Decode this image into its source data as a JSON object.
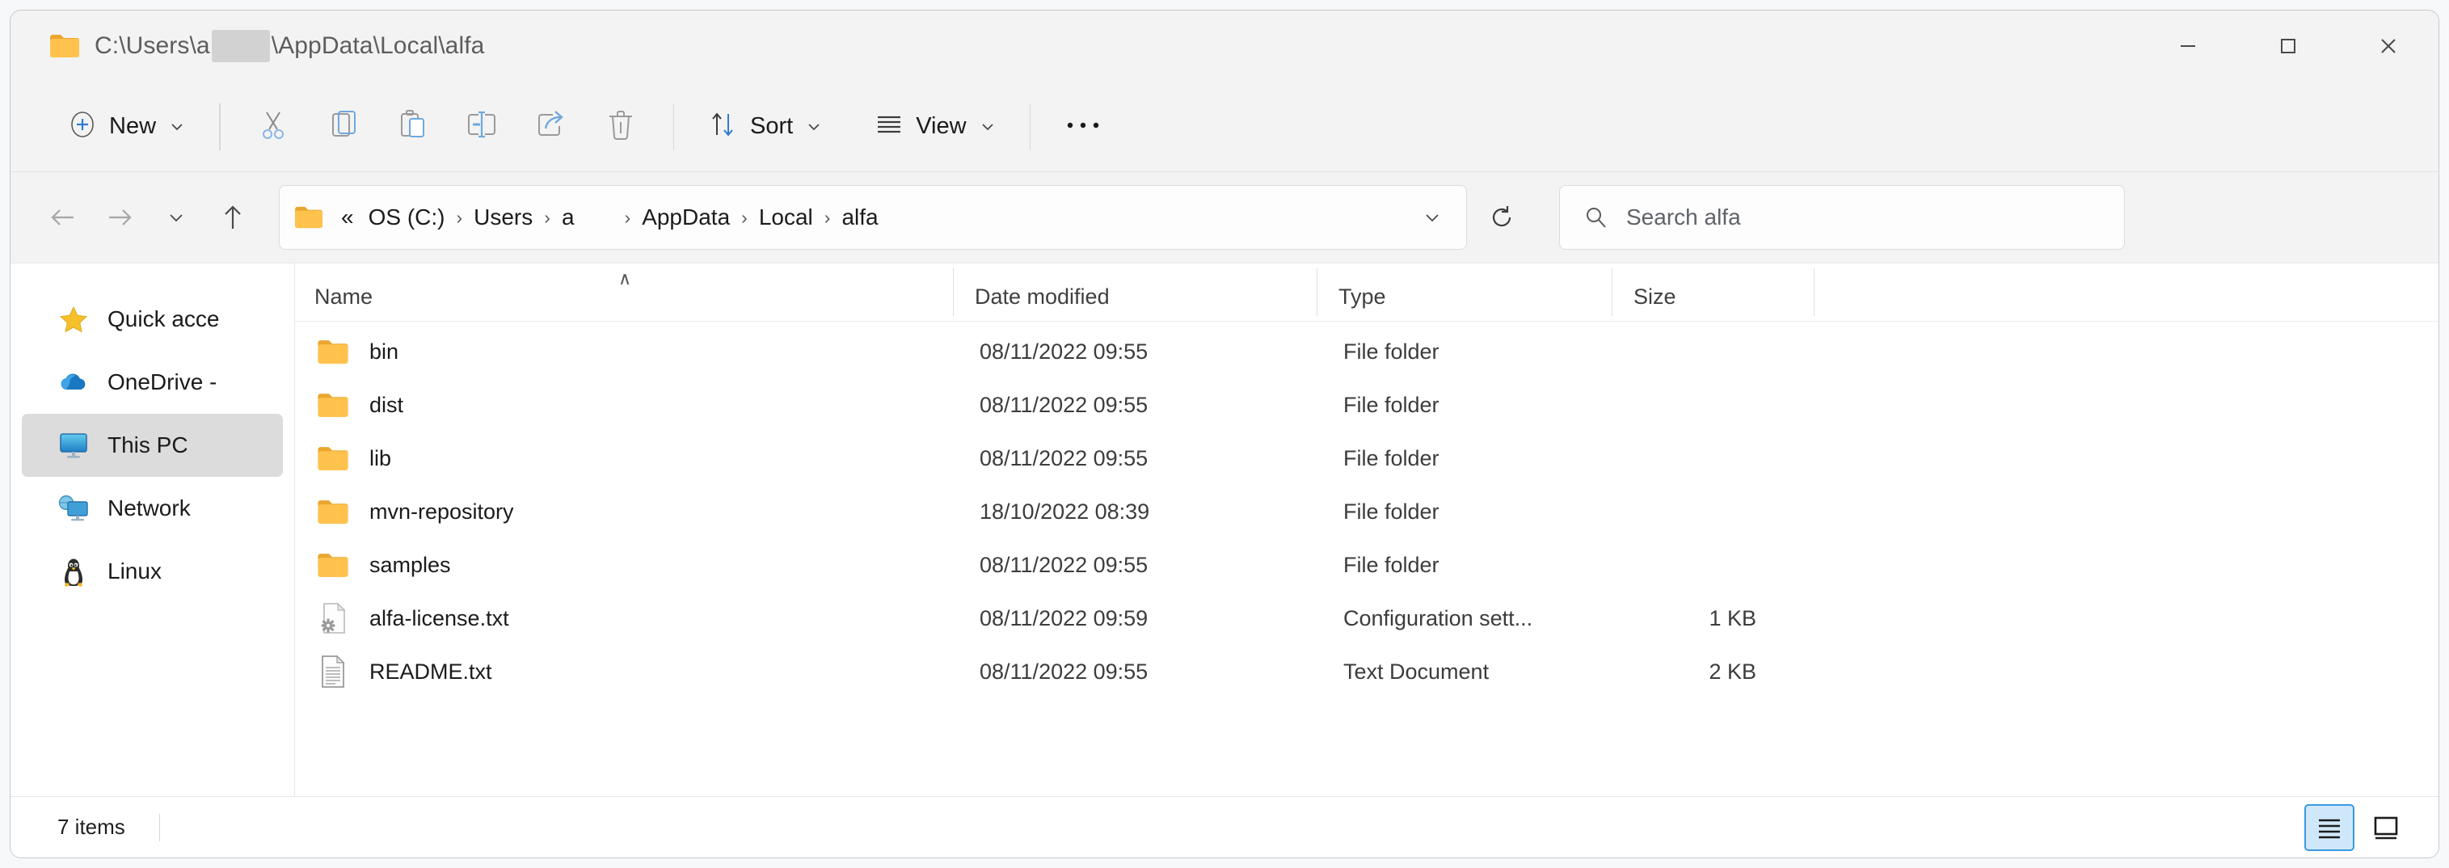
{
  "window": {
    "title_path": "C:\\Users\\a",
    "title_path_tail": "\\AppData\\Local\\alfa",
    "title_icon": "folder-icon",
    "controls": {
      "minimize": "—",
      "maximize": "☐",
      "close": "✕"
    }
  },
  "toolbar": {
    "new_label": "New",
    "sort_label": "Sort",
    "view_label": "View",
    "more_label": "•••",
    "icons": [
      "add-icon",
      "cut-icon",
      "copy-icon",
      "paste-icon",
      "rename-icon",
      "share-icon",
      "delete-icon",
      "sort-icon",
      "view-icon",
      "more-icon"
    ]
  },
  "navigation": {
    "back_label": "Back",
    "forward_label": "Forward",
    "recent_label": "Recent locations",
    "up_label": "Up",
    "refresh_label": "Refresh",
    "breadcrumb_overflow": "«",
    "breadcrumb": [
      {
        "label": "OS (C:)"
      },
      {
        "label": "Users"
      },
      {
        "label": "a"
      },
      {
        "label": "AppData"
      },
      {
        "label": "Local"
      },
      {
        "label": "alfa"
      }
    ],
    "separator": "›"
  },
  "search": {
    "placeholder": "Search alfa",
    "value": "",
    "icon": "search-icon"
  },
  "sidebar": {
    "items": [
      {
        "label": "Quick acce",
        "icon": "star-icon",
        "selected": false
      },
      {
        "label": "OneDrive -",
        "icon": "cloud-icon",
        "selected": false
      },
      {
        "label": "This PC",
        "icon": "monitor-icon",
        "selected": true
      },
      {
        "label": "Network",
        "icon": "network-icon",
        "selected": false
      },
      {
        "label": "Linux",
        "icon": "penguin-icon",
        "selected": false
      }
    ]
  },
  "file_list": {
    "columns": {
      "name": "Name",
      "date_modified": "Date modified",
      "type": "Type",
      "size": "Size"
    },
    "sort": {
      "column": "Name",
      "direction": "ascending",
      "indicator": "∧"
    },
    "rows": [
      {
        "name": "bin",
        "date": "08/11/2022 09:55",
        "type": "File folder",
        "size": "",
        "icon": "folder-icon"
      },
      {
        "name": "dist",
        "date": "08/11/2022 09:55",
        "type": "File folder",
        "size": "",
        "icon": "folder-icon"
      },
      {
        "name": "lib",
        "date": "08/11/2022 09:55",
        "type": "File folder",
        "size": "",
        "icon": "folder-icon"
      },
      {
        "name": "mvn-repository",
        "date": "18/10/2022 08:39",
        "type": "File folder",
        "size": "",
        "icon": "folder-icon"
      },
      {
        "name": "samples",
        "date": "08/11/2022 09:55",
        "type": "File folder",
        "size": "",
        "icon": "folder-icon"
      },
      {
        "name": "alfa-license.txt",
        "date": "08/11/2022 09:59",
        "type": "Configuration sett...",
        "size": "1 KB",
        "icon": "config-file-icon"
      },
      {
        "name": "README.txt",
        "date": "08/11/2022 09:55",
        "type": "Text Document",
        "size": "2 KB",
        "icon": "text-file-icon"
      }
    ]
  },
  "status_bar": {
    "item_count": "7 items",
    "details_view_label": "Details view",
    "large_icons_view_label": "Large icons view"
  },
  "colors": {
    "folder_yellow": "#ffc34d",
    "folder_yellow_dark": "#eaa62e",
    "accent_blue": "#3a9ae0",
    "selection_gray": "#dcdcdc",
    "window_bg": "#f3f3f3"
  }
}
